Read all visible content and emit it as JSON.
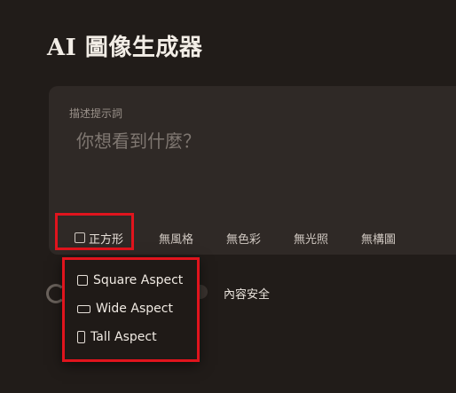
{
  "header": {
    "title": "AI 圖像生成器"
  },
  "prompt": {
    "label": "描述提示詞",
    "placeholder": "你想看到什麼？"
  },
  "toolbar": {
    "aspect_label": "正方形",
    "style_label": "無風格",
    "color_label": "無色彩",
    "lighting_label": "無光照",
    "composition_label": "無構圖"
  },
  "safety": {
    "label": "內容安全"
  },
  "aspect_menu": {
    "square": "Square Aspect",
    "wide": "Wide Aspect",
    "tall": "Tall Aspect"
  },
  "colors": {
    "background": "#211c19",
    "panel": "#2f2926",
    "highlight": "#e0141d"
  }
}
